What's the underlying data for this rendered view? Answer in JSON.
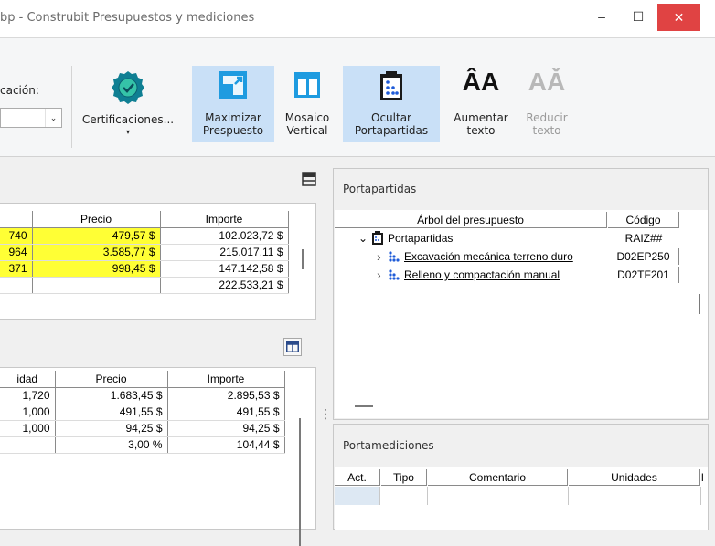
{
  "window": {
    "title": "bp - Construbit Presupuestos y mediciones",
    "min_label": "–",
    "max_label": "☐",
    "close_label": "✕"
  },
  "ribbon": {
    "location_label": "cación:",
    "combo_arrow": "⌄",
    "certificaciones": {
      "label": "Certificaciones...",
      "caret": "▾"
    },
    "maximizar": {
      "line1": "Maximizar",
      "line2": "Prespuesto",
      "active": true
    },
    "mosaico": {
      "line1": "Mosaico",
      "line2": "Vertical"
    },
    "ocultar": {
      "line1": "Ocultar",
      "line2": "Portapartidas",
      "active": true
    },
    "aumentar": {
      "glyph": "ÂA",
      "line1": "Aumentar",
      "line2": "texto"
    },
    "reducir": {
      "glyph": "AǍ",
      "line1": "Reducir",
      "line2": "texto",
      "disabled": true
    }
  },
  "top_grid": {
    "headers": {
      "qty": "",
      "precio": "Precio",
      "importe": "Importe"
    },
    "rows": [
      {
        "qty": "740",
        "precio": "479,57 $",
        "importe": "102.023,72 $",
        "highlight": true
      },
      {
        "qty": "964",
        "precio": "3.585,77 $",
        "importe": "215.017,11 $",
        "highlight": true
      },
      {
        "qty": "371",
        "precio": "998,45 $",
        "importe": "147.142,58 $",
        "highlight": true
      },
      {
        "qty": "",
        "precio": "",
        "importe": "222.533,21 $",
        "highlight": false
      }
    ]
  },
  "bottom_grid": {
    "headers": {
      "qty": "idad",
      "precio": "Precio",
      "importe": "Importe"
    },
    "rows": [
      {
        "qty": "1,720",
        "precio": "1.683,45 $",
        "importe": "2.895,53 $"
      },
      {
        "qty": "1,000",
        "precio": "491,55 $",
        "importe": "491,55 $"
      },
      {
        "qty": "1,000",
        "precio": "94,25 $",
        "importe": "94,25 $"
      },
      {
        "qty": "",
        "precio": "3,00 %",
        "importe": "104,44 $"
      }
    ]
  },
  "portapartidas": {
    "title": "Portapartidas",
    "col_tree": "Árbol del presupuesto",
    "col_code": "Código",
    "root": {
      "label": "Portapartidas",
      "code": "RAIZ##",
      "expander": "⌄"
    },
    "items": [
      {
        "label": "Excavación mecánica terreno duro",
        "code": "D02EP250",
        "expander": "›"
      },
      {
        "label": "Relleno y compactación manual",
        "code": "D02TF201",
        "expander": "›"
      }
    ]
  },
  "portamediciones": {
    "title": "Portamediciones",
    "headers": {
      "act": "Act.",
      "tipo": "Tipo",
      "comentario": "Comentario",
      "unidades": "Unidades",
      "extra": "l"
    }
  },
  "splitter_handle": "⋮",
  "colors": {
    "highlight": "#ffff35",
    "active_button": "#c9e0f7",
    "close_button": "#e04343",
    "tree_icon_blue": "#1e5bd8"
  }
}
